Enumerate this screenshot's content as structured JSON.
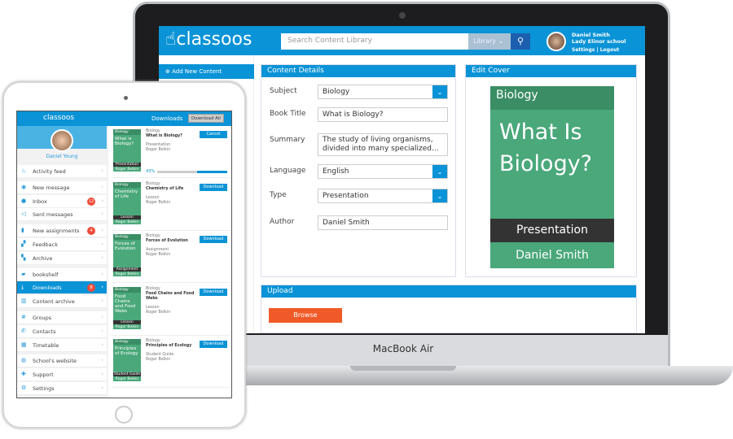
{
  "laptop": {
    "brand": "MacBook Air",
    "header": {
      "logo": "classoos",
      "search_placeholder": "Search Content Library",
      "library_select": "Library",
      "user_name": "Daniel Smith",
      "school": "Lady Elinor school",
      "settings": "Settings",
      "separator": "|",
      "logout": "Logout"
    },
    "sidebar": {
      "add_new": "Add New Content"
    },
    "content_details": {
      "title": "Content Details",
      "fields": [
        {
          "label": "Subject",
          "value": "Biology",
          "dropdown": true
        },
        {
          "label": "Book Title",
          "value": "What is Biology?",
          "dropdown": false
        },
        {
          "label": "Summary",
          "value": "The study of living organisms, divided into many specialized...",
          "dropdown": false
        },
        {
          "label": "Language",
          "value": "English",
          "dropdown": true
        },
        {
          "label": "Type",
          "value": "Presentation",
          "dropdown": true
        },
        {
          "label": "Author",
          "value": "Daniel Smith",
          "dropdown": false
        }
      ]
    },
    "edit_cover": {
      "title": "Edit Cover",
      "subject": "Biology",
      "book_title": "What Is Biology?",
      "type": "Presentation",
      "author": "Daniel Smith"
    },
    "upload": {
      "title": "Upload",
      "browse": "Browse"
    },
    "colors": {
      "primary": "#0a93d6",
      "accent": "#f05a28",
      "cover": "#4aa87a"
    }
  },
  "tablet": {
    "logo": "classoos",
    "user": "Daniel Young",
    "menu": [
      {
        "label": "Activity feed",
        "icon": "flame-icon"
      },
      {
        "label": "New message",
        "icon": "compose-icon"
      },
      {
        "label": "Inbox",
        "icon": "chat-icon",
        "badge": "12"
      },
      {
        "label": "Sent messages",
        "icon": "send-icon"
      },
      {
        "label": "New assignments",
        "icon": "assignment-icon",
        "badge": "4"
      },
      {
        "label": "Feedback",
        "icon": "feedback-icon"
      },
      {
        "label": "Archive",
        "icon": "archive-icon"
      },
      {
        "label": "bookshelf",
        "icon": "book-icon"
      },
      {
        "label": "Downloads",
        "icon": "download-icon",
        "badge": "8",
        "active": true
      },
      {
        "label": "Content archive",
        "icon": "library-icon"
      },
      {
        "label": "Groups",
        "icon": "groups-icon"
      },
      {
        "label": "Contacts",
        "icon": "phone-icon"
      },
      {
        "label": "Timetable",
        "icon": "calendar-icon"
      },
      {
        "label": "School's website",
        "icon": "globe-icon"
      },
      {
        "label": "Support",
        "icon": "support-icon"
      },
      {
        "label": "Settings",
        "icon": "gear-icon"
      }
    ],
    "downloads": {
      "title": "Downloads",
      "download_all": "Download All",
      "items": [
        {
          "subject": "Biology",
          "title": "What is Biology?",
          "type": "Presentation",
          "author": "Roger Belkin",
          "button": "Cancel",
          "progress_label": "43%",
          "progress": 43
        },
        {
          "subject": "Biology",
          "title": "Chemistry of Life",
          "type": "Lesson",
          "author": "Roger Belkin",
          "button": "Download"
        },
        {
          "subject": "Biology",
          "title": "Forces of Evolution",
          "type": "Assignment",
          "author": "Roger Belkin",
          "button": "Download"
        },
        {
          "subject": "Biology",
          "title": "Food Chains and Food Webs",
          "type": "Lesson",
          "author": "Roger Belkin",
          "button": "Download"
        },
        {
          "subject": "Biology",
          "title": "Principles of Ecology",
          "type": "Student Guide",
          "author": "Roger Belkin",
          "button": "Download"
        }
      ]
    }
  }
}
